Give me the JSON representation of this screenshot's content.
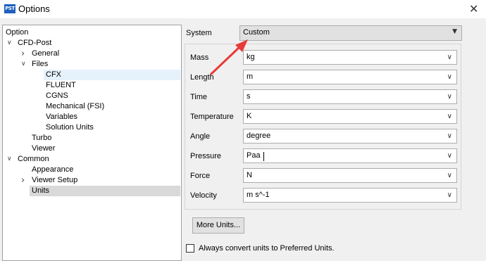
{
  "window": {
    "app_icon": "PST",
    "title": "Options"
  },
  "tree": {
    "items": [
      {
        "label": "Option",
        "depth": 0,
        "twisty": ""
      },
      {
        "label": "CFD-Post",
        "depth": 1,
        "twisty": "expanded"
      },
      {
        "label": "General",
        "depth": 2,
        "twisty": "collapsed"
      },
      {
        "label": "Files",
        "depth": 2,
        "twisty": "expanded"
      },
      {
        "label": "CFX",
        "depth": 3,
        "twisty": "",
        "state": "current"
      },
      {
        "label": "FLUENT",
        "depth": 3,
        "twisty": ""
      },
      {
        "label": "CGNS",
        "depth": 3,
        "twisty": ""
      },
      {
        "label": "Mechanical (FSI)",
        "depth": 3,
        "twisty": ""
      },
      {
        "label": "Variables",
        "depth": 3,
        "twisty": ""
      },
      {
        "label": "Solution Units",
        "depth": 3,
        "twisty": ""
      },
      {
        "label": "Turbo",
        "depth": 2,
        "twisty": ""
      },
      {
        "label": "Viewer",
        "depth": 2,
        "twisty": ""
      },
      {
        "label": "Common",
        "depth": 1,
        "twisty": "expanded"
      },
      {
        "label": "Appearance",
        "depth": 2,
        "twisty": ""
      },
      {
        "label": "Viewer Setup",
        "depth": 2,
        "twisty": "collapsed"
      },
      {
        "label": "Units",
        "depth": 2,
        "twisty": "",
        "state": "selected"
      }
    ]
  },
  "system": {
    "label": "System",
    "value": "Custom"
  },
  "units": [
    {
      "label": "Mass",
      "value": "kg"
    },
    {
      "label": "Length",
      "value": "m"
    },
    {
      "label": "Time",
      "value": "s"
    },
    {
      "label": "Temperature",
      "value": "K"
    },
    {
      "label": "Angle",
      "value": "degree"
    },
    {
      "label": "Pressure",
      "value": "Paa",
      "editing": true
    },
    {
      "label": "Force",
      "value": "N"
    },
    {
      "label": "Velocity",
      "value": "m s^-1"
    }
  ],
  "more_units_button": "More Units...",
  "always_convert": {
    "label": "Always convert units to Preferred Units.",
    "checked": false
  },
  "icons": {
    "close": "close-icon",
    "dropdown": "chevron-down-icon",
    "expanded": "chevron-down-icon",
    "collapsed": "chevron-right-icon"
  },
  "colors": {
    "annotation_arrow": "#e83a3a",
    "tree_current": "#e5f1fb",
    "tree_selected": "#d9d9d9"
  }
}
